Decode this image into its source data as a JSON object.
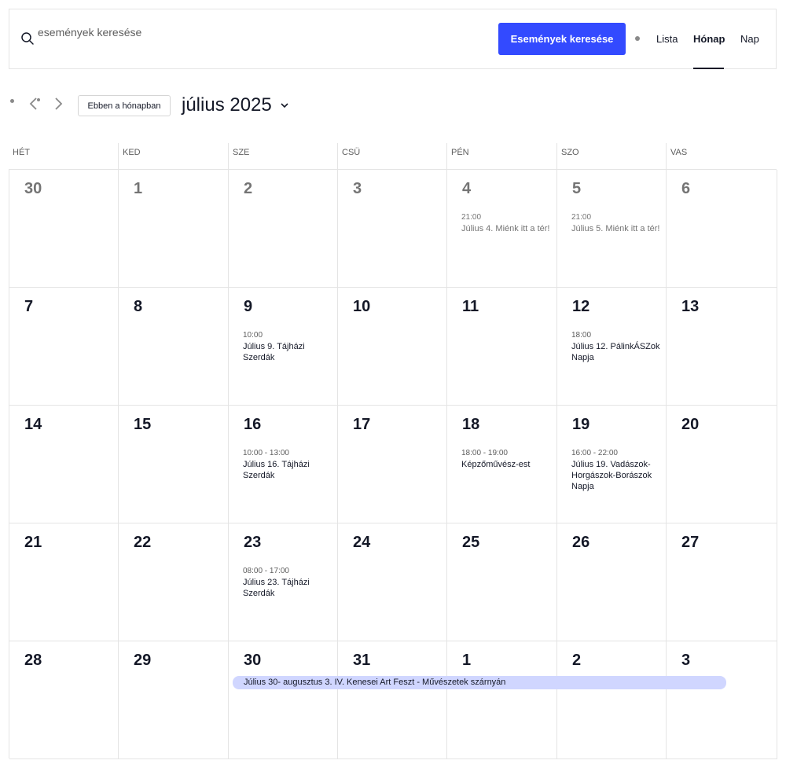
{
  "search": {
    "placeholder": "események keresése",
    "button_label": "Események keresése"
  },
  "views": {
    "list": "Lista",
    "month": "Hónap",
    "day": "Nap",
    "active": "Hónap"
  },
  "nav": {
    "today_label": "Ebben a hónapban",
    "month_title": "július 2025"
  },
  "weekdays": [
    "HÉT",
    "KED",
    "SZE",
    "CSÜ",
    "PÉN",
    "SZO",
    "VAS"
  ],
  "weeks": [
    [
      {
        "day": "30",
        "past": true
      },
      {
        "day": "1",
        "past": true
      },
      {
        "day": "2",
        "past": true
      },
      {
        "day": "3",
        "past": true
      },
      {
        "day": "4",
        "past": true,
        "time": "21:00",
        "title": "Július 4. Miénk itt a tér!"
      },
      {
        "day": "5",
        "past": true,
        "time": "21:00",
        "title": "Július 5. Miénk itt a tér!"
      },
      {
        "day": "6",
        "past": true
      }
    ],
    [
      {
        "day": "7"
      },
      {
        "day": "8"
      },
      {
        "day": "9",
        "time": "10:00",
        "title": "Július 9. Tájházi Szerdák"
      },
      {
        "day": "10"
      },
      {
        "day": "11"
      },
      {
        "day": "12",
        "time": "18:00",
        "title": "Július 12. PálinkÁSZok Napja"
      },
      {
        "day": "13"
      }
    ],
    [
      {
        "day": "14"
      },
      {
        "day": "15"
      },
      {
        "day": "16",
        "time": "10:00 - 13:00",
        "title": "Július 16. Tájházi Szerdák"
      },
      {
        "day": "17"
      },
      {
        "day": "18",
        "time": "18:00 - 19:00",
        "title": "Képzőművész-est"
      },
      {
        "day": "19",
        "time": "16:00 - 22:00",
        "title": "Július 19. Vadászok-Horgászok-Borászok Napja"
      },
      {
        "day": "20"
      }
    ],
    [
      {
        "day": "21"
      },
      {
        "day": "22"
      },
      {
        "day": "23",
        "time": "08:00 - 17:00",
        "title": "Július 23. Tájházi Szerdák"
      },
      {
        "day": "24"
      },
      {
        "day": "25"
      },
      {
        "day": "26"
      },
      {
        "day": "27"
      }
    ],
    [
      {
        "day": "28"
      },
      {
        "day": "29"
      },
      {
        "day": "30"
      },
      {
        "day": "31"
      },
      {
        "day": "1"
      },
      {
        "day": "2"
      },
      {
        "day": "3"
      }
    ]
  ],
  "multiday_event": {
    "title": "Július 30- augusztus 3. IV. Kenesei Art Feszt - Művészetek szárnyán"
  },
  "colors": {
    "accent": "#334aff",
    "multiday_bg": "#d0d6ff",
    "text": "#141827",
    "muted": "#747474"
  }
}
